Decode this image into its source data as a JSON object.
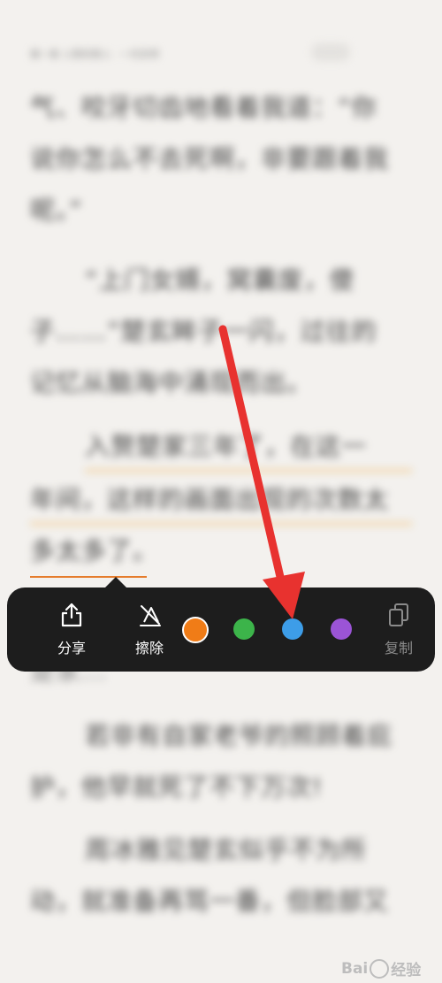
{
  "reader": {
    "header_left": "第一章 入赘的男人 · 一代宗师",
    "header_right": "",
    "lines": [
      "气、咬牙切齿地看着我道：“你",
      "说你怎么不去死啊，非要跟着我",
      "呢。”",
      "“上门女婿，窝囊废，傻",
      "子……”楚玄眸子一闪，过往的",
      "记忆从脑海中涌现而出。",
      "入赘楚家三年了，在这一",
      "年间，这样的画面出现的次数太",
      "多太多了。",
      "",
      "楚家...",
      "若非有自家老爷的照顾着庇",
      "护，他早就死了不下万次!",
      "周冰雅见楚玄似乎不为所",
      "动，就准备再骂一番，但脸部又"
    ]
  },
  "toolbar": {
    "share_label": "分享",
    "erase_label": "擦除",
    "copy_label": "复制",
    "colors": {
      "orange": "#f07c17",
      "green": "#3cb44a",
      "blue": "#3d9de8",
      "purple": "#9b54d6"
    },
    "selected_color": "orange"
  },
  "annotation": {
    "arrow_color": "#e8322f"
  },
  "watermark": {
    "brand": "Bai",
    "brand2": "经验",
    "sub": ""
  }
}
